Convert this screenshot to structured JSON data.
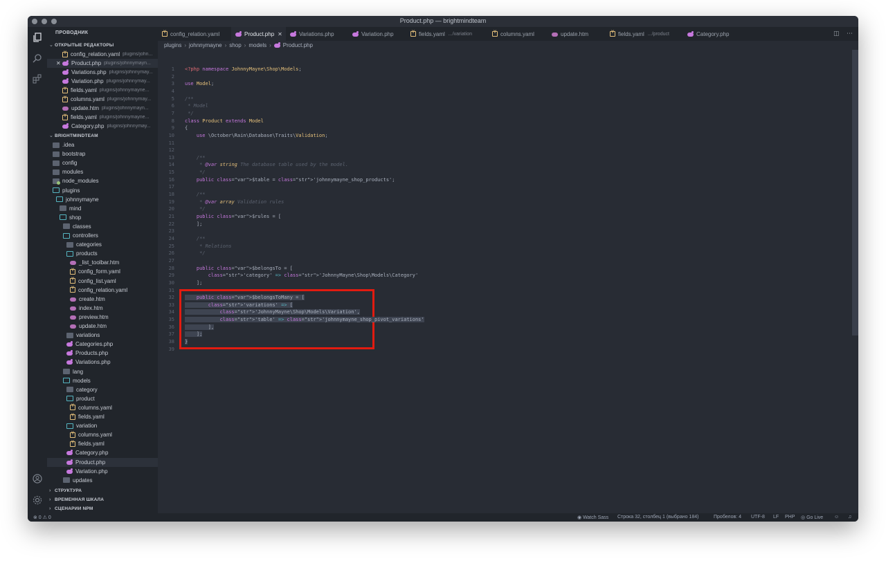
{
  "window": {
    "title": "Product.php — brightmindteam"
  },
  "explorer": {
    "header": "ПРОВОДНИК",
    "open_editors_title": "ОТКРЫТЫЕ РЕДАКТОРЫ",
    "open_editors": [
      {
        "name": "config_relation.yaml",
        "path": "plugins/john...",
        "icon": "yaml"
      },
      {
        "name": "Product.php",
        "path": "plugins/johnnymayn...",
        "icon": "php",
        "active": true
      },
      {
        "name": "Variations.php",
        "path": "plugins/johnnymay...",
        "icon": "php"
      },
      {
        "name": "Variation.php",
        "path": "plugins/johnnymay...",
        "icon": "php"
      },
      {
        "name": "fields.yaml",
        "path": "plugins/johnnymayne...",
        "icon": "yaml"
      },
      {
        "name": "columns.yaml",
        "path": "plugins/johnnymay...",
        "icon": "yaml"
      },
      {
        "name": "update.htm",
        "path": "plugins/johnnymayn...",
        "icon": "htm"
      },
      {
        "name": "fields.yaml",
        "path": "plugins/johnnymayne...",
        "icon": "yaml"
      },
      {
        "name": "Category.php",
        "path": "plugins/johnnymay...",
        "icon": "php"
      }
    ],
    "workspace_title": "BRIGHTMINDTEAM",
    "tree": [
      {
        "name": ".idea",
        "icon": "folder",
        "depth": 0
      },
      {
        "name": "bootstrap",
        "icon": "folder",
        "depth": 0
      },
      {
        "name": "config",
        "icon": "folder",
        "depth": 0
      },
      {
        "name": "modules",
        "icon": "folder",
        "depth": 0
      },
      {
        "name": "node_modules",
        "icon": "dot",
        "depth": 0
      },
      {
        "name": "plugins",
        "icon": "folder-open",
        "depth": 0
      },
      {
        "name": "johnnymayne",
        "icon": "folder-open",
        "depth": 1
      },
      {
        "name": "mind",
        "icon": "folder",
        "depth": 2
      },
      {
        "name": "shop",
        "icon": "folder-open",
        "depth": 2
      },
      {
        "name": "classes",
        "icon": "folder",
        "depth": 3
      },
      {
        "name": "controllers",
        "icon": "folder-open",
        "depth": 3
      },
      {
        "name": "categories",
        "icon": "folder",
        "depth": 4
      },
      {
        "name": "products",
        "icon": "folder-open",
        "depth": 4
      },
      {
        "name": "_list_toolbar.htm",
        "icon": "htm",
        "depth": 5
      },
      {
        "name": "config_form.yaml",
        "icon": "yaml",
        "depth": 5
      },
      {
        "name": "config_list.yaml",
        "icon": "yaml",
        "depth": 5
      },
      {
        "name": "config_relation.yaml",
        "icon": "yaml",
        "depth": 5
      },
      {
        "name": "create.htm",
        "icon": "htm",
        "depth": 5
      },
      {
        "name": "index.htm",
        "icon": "htm",
        "depth": 5
      },
      {
        "name": "preview.htm",
        "icon": "htm",
        "depth": 5
      },
      {
        "name": "update.htm",
        "icon": "htm",
        "depth": 5
      },
      {
        "name": "variations",
        "icon": "folder",
        "depth": 4
      },
      {
        "name": "Categories.php",
        "icon": "php",
        "depth": 4
      },
      {
        "name": "Products.php",
        "icon": "php",
        "depth": 4
      },
      {
        "name": "Variations.php",
        "icon": "php",
        "depth": 4
      },
      {
        "name": "lang",
        "icon": "folder",
        "depth": 3
      },
      {
        "name": "models",
        "icon": "folder-open",
        "depth": 3
      },
      {
        "name": "category",
        "icon": "folder",
        "depth": 4
      },
      {
        "name": "product",
        "icon": "folder-open",
        "depth": 4
      },
      {
        "name": "columns.yaml",
        "icon": "yaml",
        "depth": 5
      },
      {
        "name": "fields.yaml",
        "icon": "yaml",
        "depth": 5
      },
      {
        "name": "variation",
        "icon": "folder-open",
        "depth": 4
      },
      {
        "name": "columns.yaml",
        "icon": "yaml",
        "depth": 5
      },
      {
        "name": "fields.yaml",
        "icon": "yaml",
        "depth": 5
      },
      {
        "name": "Category.php",
        "icon": "php",
        "depth": 4
      },
      {
        "name": "Product.php",
        "icon": "php",
        "depth": 4,
        "selected": true
      },
      {
        "name": "Variation.php",
        "icon": "php",
        "depth": 4
      },
      {
        "name": "updates",
        "icon": "folder",
        "depth": 3
      }
    ],
    "bottom_sections": [
      "СТРУКТУРА",
      "ВРЕМЕННАЯ ШКАЛА",
      "СЦЕНАРИИ NPM"
    ]
  },
  "tabs": [
    {
      "label": "config_relation.yaml",
      "icon": "yaml"
    },
    {
      "label": "Product.php",
      "icon": "php",
      "active": true
    },
    {
      "label": "Variations.php",
      "icon": "php"
    },
    {
      "label": "Variation.php",
      "icon": "php"
    },
    {
      "label": "fields.yaml",
      "sub": ".../variation",
      "icon": "yaml"
    },
    {
      "label": "columns.yaml",
      "icon": "yaml"
    },
    {
      "label": "update.htm",
      "icon": "htm"
    },
    {
      "label": "fields.yaml",
      "sub": ".../product",
      "icon": "yaml"
    },
    {
      "label": "Category.php",
      "icon": "php"
    }
  ],
  "breadcrumb": [
    "plugins",
    "johnnymayne",
    "shop",
    "models",
    "Product.php"
  ],
  "code_lines": [
    "<?php namespace JohnnyMayne\\Shop\\Models;",
    "",
    "use Model;",
    "",
    "/**",
    " * Model",
    " */",
    "class Product extends Model",
    "{",
    "    use \\October\\Rain\\Database\\Traits\\Validation;",
    "",
    "",
    "    /**",
    "     * @var string The database table used by the model.",
    "     */",
    "    public $table = 'johnnymayne_shop_products';",
    "",
    "    /**",
    "     * @var array Validation rules",
    "     */",
    "    public $rules = [",
    "    ];",
    "",
    "    /**",
    "     * Relations",
    "     */",
    "",
    "    public $belongsTo = [",
    "        'category' => 'JohnnyMayne\\Shop\\Models\\Category'",
    "    ];",
    "",
    "    public $belongsToMany = [",
    "        'variations' => [",
    "            'JohnnyMayne\\Shop\\Models\\Variation',",
    "            'table' => 'johnnymayne_shop_pivot_variations'",
    "        ],",
    "    ];",
    "}",
    ""
  ],
  "status": {
    "problems": "⊗ 0 ⚠ 0",
    "watch_sass": "Watch Sass",
    "cursor": "Строка 32, столбец 1 (выбрано 184)",
    "spaces": "Пробелов: 4",
    "encoding": "UTF-8",
    "eol": "LF",
    "language": "PHP",
    "go_live": "Go Live"
  },
  "colors": {
    "highlight_box": "#e21b10",
    "editor_bg": "#282c34",
    "sidebar_bg": "#21252b"
  }
}
